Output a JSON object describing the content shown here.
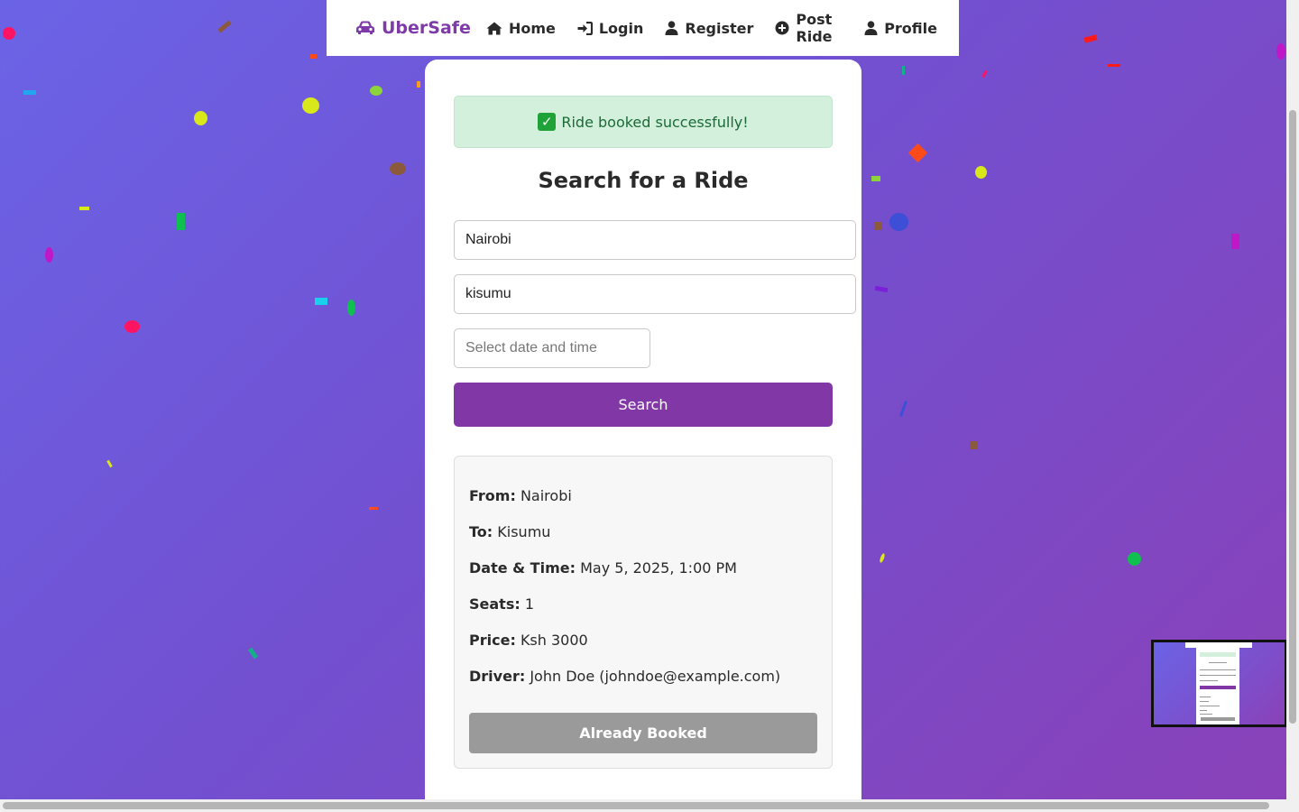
{
  "nav": {
    "brand": "UberSafe",
    "items": [
      {
        "label": "Home",
        "icon": "home-icon"
      },
      {
        "label": "Login",
        "icon": "sign-in-icon"
      },
      {
        "label": "Register",
        "icon": "user-icon"
      },
      {
        "label": "Post Ride",
        "icon": "plus-circle-icon"
      },
      {
        "label": "Profile",
        "icon": "user-icon"
      }
    ]
  },
  "alert": {
    "text": "Ride booked successfully!",
    "icon": "check-icon"
  },
  "search": {
    "heading": "Search for a Ride",
    "from_value": "Nairobi",
    "to_value": "kisumu",
    "date_placeholder": "Select date and time",
    "button_label": "Search"
  },
  "result": {
    "from_label": "From:",
    "from_value": "Nairobi",
    "to_label": "To:",
    "to_value": "Kisumu",
    "datetime_label": "Date & Time:",
    "datetime_value": "May 5, 2025, 1:00 PM",
    "seats_label": "Seats:",
    "seats_value": "1",
    "price_label": "Price:",
    "price_value": "Ksh 3000",
    "driver_label": "Driver:",
    "driver_value": "John Doe (johndoe@example.com)",
    "button_label": "Already Booked"
  },
  "colors": {
    "brand": "#7d3aa8",
    "primary_button": "#8137a6",
    "disabled_button": "#9a9a9a",
    "success_bg": "#d3f0dc",
    "success_text": "#1b6a35"
  }
}
